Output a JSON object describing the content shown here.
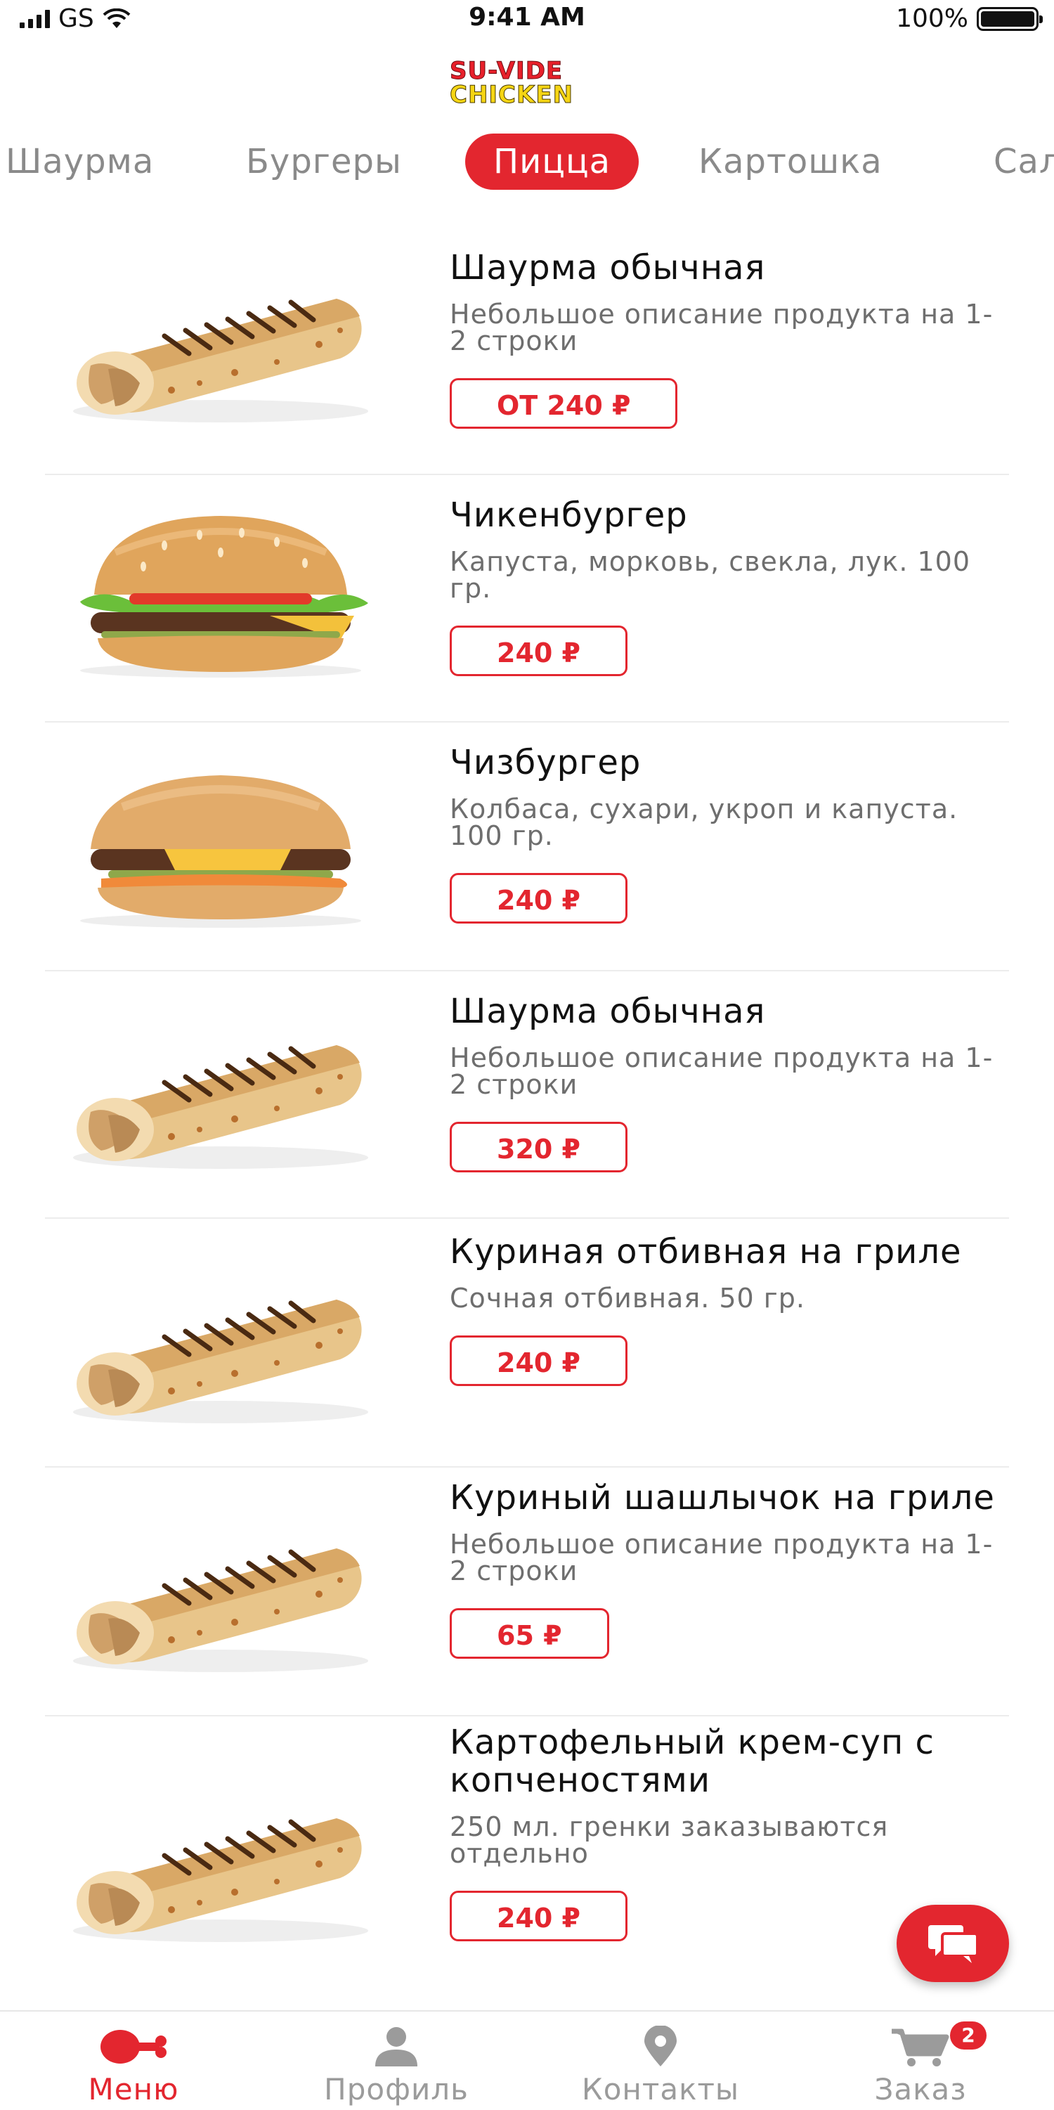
{
  "status_bar": {
    "carrier": "GS",
    "time": "9:41 AM",
    "battery": "100%"
  },
  "logo": {
    "line1": "SU-VIDE",
    "line2": "CHICKEN"
  },
  "categories": [
    {
      "label": "Шаурма"
    },
    {
      "label": "Бургеры"
    },
    {
      "label": "Пицца",
      "active": true
    },
    {
      "label": "Картошка"
    },
    {
      "label": "Салаты"
    }
  ],
  "products": [
    {
      "title": "Шаурма обычная",
      "description": "Небольшое описание продукта на 1-2 строки",
      "price": "ОТ 240 ₽",
      "image": "shawarma"
    },
    {
      "title": "Чикенбургер",
      "description": "Капуста, морковь, свекла, лук. 100 гр.",
      "price": "240 ₽",
      "image": "burger-lettuce"
    },
    {
      "title": "Чизбургер",
      "description": "Колбаса, сухари, укроп и капуста. 100 гр.",
      "price": "240 ₽",
      "image": "cheeseburger"
    },
    {
      "title": "Шаурма обычная",
      "description": "Небольшое описание продукта на 1-2 строки",
      "price": "320 ₽",
      "image": "shawarma"
    },
    {
      "title": "Куриная отбивная на гриле",
      "description": "Сочная отбивная. 50 гр.",
      "price": "240 ₽",
      "image": "shawarma"
    },
    {
      "title": "Куриный шашлычок на гриле",
      "description": "Небольшое описание продукта на 1-2 строки",
      "price": "65 ₽",
      "image": "shawarma"
    },
    {
      "title": "Картофельный крем-суп с копченостями",
      "description": "250 мл. гренки заказываются отдельно",
      "price": "240 ₽",
      "image": "shawarma"
    }
  ],
  "tab_bar": [
    {
      "label": "Меню",
      "icon": "chicken-leg-icon",
      "active": true
    },
    {
      "label": "Профиль",
      "icon": "person-icon"
    },
    {
      "label": "Контакты",
      "icon": "location-pin-icon"
    },
    {
      "label": "Заказ",
      "icon": "cart-icon",
      "badge": "2"
    }
  ],
  "colors": {
    "accent": "#e3262f",
    "muted": "#9b9b9b"
  }
}
